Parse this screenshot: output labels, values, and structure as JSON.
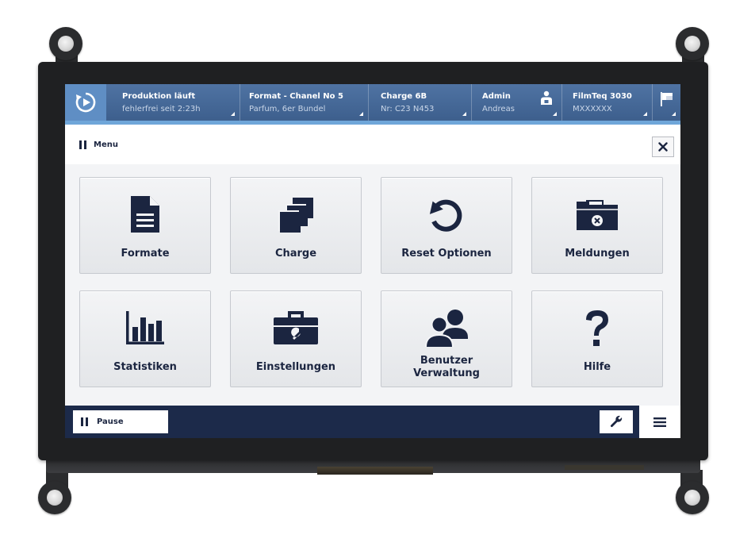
{
  "header": {
    "status": {
      "title": "Produktion läuft",
      "subtitle": "fehlerfrei seit 2:23h"
    },
    "format": {
      "title": "Format - Chanel No 5",
      "subtitle": "Parfum, 6er Bundel"
    },
    "charge": {
      "title": "Charge 6B",
      "subtitle": "Nr: C23 N453"
    },
    "user": {
      "title": "Admin",
      "subtitle": "Andreas"
    },
    "machine": {
      "title": "FilmTeq 3030",
      "subtitle": "MXXXXXX"
    }
  },
  "menu": {
    "title": "Menu"
  },
  "tiles": [
    {
      "label": "Formate",
      "icon": "document-icon"
    },
    {
      "label": "Charge",
      "icon": "stack-icon"
    },
    {
      "label": "Reset Optionen",
      "icon": "reset-icon"
    },
    {
      "label": "Meldungen",
      "icon": "folder-alert-icon"
    },
    {
      "label": "Statistiken",
      "icon": "bar-chart-icon"
    },
    {
      "label": "Einstellungen",
      "icon": "toolbox-icon"
    },
    {
      "label_line1": "Benutzer",
      "label_line2": "Verwaltung",
      "icon": "users-icon"
    },
    {
      "label": "Hilfe",
      "icon": "question-icon"
    }
  ],
  "footer": {
    "pause_label": "Pause"
  },
  "colors": {
    "header_bg": "#4a6d9c",
    "accent": "#6fa6d9",
    "navy": "#1b2540",
    "footer_bg": "#1c2a4a"
  }
}
